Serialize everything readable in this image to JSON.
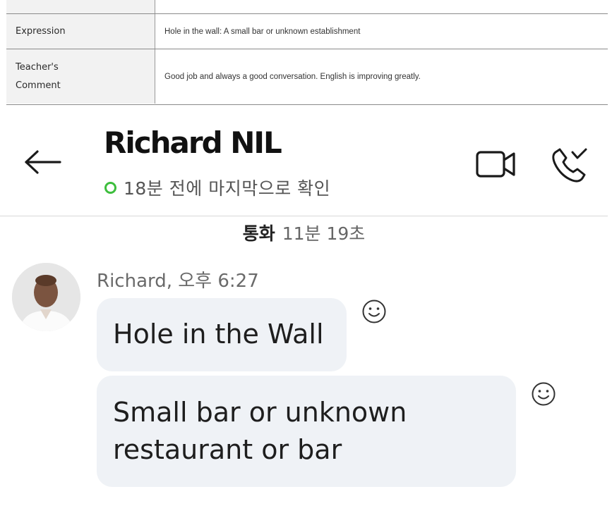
{
  "table": {
    "expression_label": "Expression",
    "expression_value": "Hole in the wall: A small bar or unknown establishment",
    "comment_label_line1": "Teacher's",
    "comment_label_line2": "Comment",
    "comment_value": "Good job and always a good conversation. English is improving greatly."
  },
  "header": {
    "contact_name": "Richard NIL",
    "presence_text": "18분 전에 마지막으로 확인",
    "presence_color": "#3dbe3d"
  },
  "call": {
    "label": "통화",
    "duration": "11분 19초"
  },
  "messages": {
    "sender_line": "Richard, 오후 6:27",
    "items": [
      {
        "text": "Hole in the Wall"
      },
      {
        "line1": "Small bar or unknown",
        "line2": "restaurant or bar"
      }
    ]
  },
  "icons": {
    "back": "back-arrow-icon",
    "video": "video-call-icon",
    "phone": "phone-call-icon",
    "reaction": "smiley-reaction-icon"
  }
}
